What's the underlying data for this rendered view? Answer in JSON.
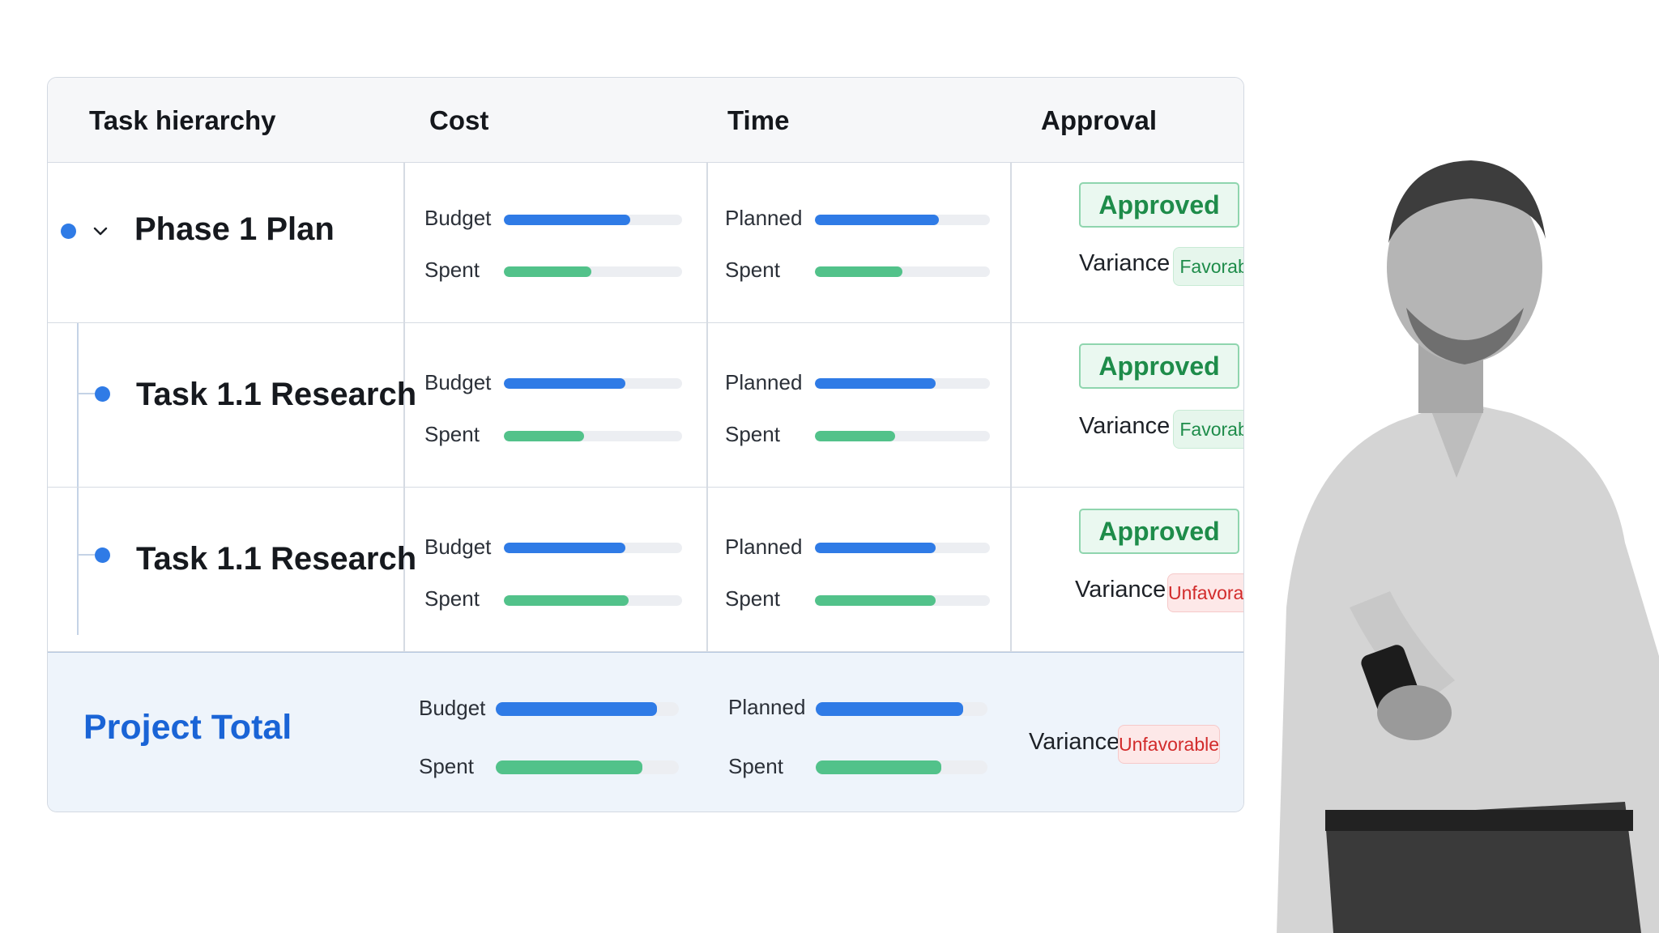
{
  "headers": {
    "task": "Task hierarchy",
    "cost": "Cost",
    "time": "Time",
    "approval": "Approval"
  },
  "rows": [
    {
      "name": "Phase 1 Plan",
      "cost": {
        "budget_label": "Budget",
        "budget": 0.71,
        "spent_label": "Spent",
        "spent": 0.49
      },
      "time": {
        "planned_label": "Planned",
        "planned": 0.71,
        "spent_label": "Spent",
        "spent": 0.5
      },
      "status": "Approved",
      "variance_label": "Variance",
      "variance": "Favorable"
    },
    {
      "name": "Task 1.1 Research",
      "cost": {
        "budget_label": "Budget",
        "budget": 0.68,
        "spent_label": "Spent",
        "spent": 0.45
      },
      "time": {
        "planned_label": "Planned",
        "planned": 0.69,
        "spent_label": "Spent",
        "spent": 0.46
      },
      "status": "Approved",
      "variance_label": "Variance",
      "variance": "Favorable"
    },
    {
      "name": "Task 1.1 Research",
      "cost": {
        "budget_label": "Budget",
        "budget": 0.68,
        "spent_label": "Spent",
        "spent": 0.7
      },
      "time": {
        "planned_label": "Planned",
        "planned": 0.69,
        "spent_label": "Spent",
        "spent": 0.69
      },
      "status": "Approved",
      "variance_label": "Variance",
      "variance": "Unfavorable"
    }
  ],
  "total": {
    "name": "Project Total",
    "cost": {
      "budget_label": "Budget",
      "budget": 0.88,
      "spent_label": "Spent",
      "spent": 0.8
    },
    "time": {
      "planned_label": "Planned",
      "planned": 0.86,
      "spent_label": "Spent",
      "spent": 0.73
    },
    "variance_label": "Variance",
    "variance": "Unfavorable"
  },
  "colors": {
    "accent": "#2f7be6",
    "success": "#1e8c4a",
    "danger": "#d22b2b",
    "spent_bar": "#52c28a"
  },
  "icons": {
    "expand": "chevron-down-icon",
    "node": "tree-node-dot-icon"
  }
}
